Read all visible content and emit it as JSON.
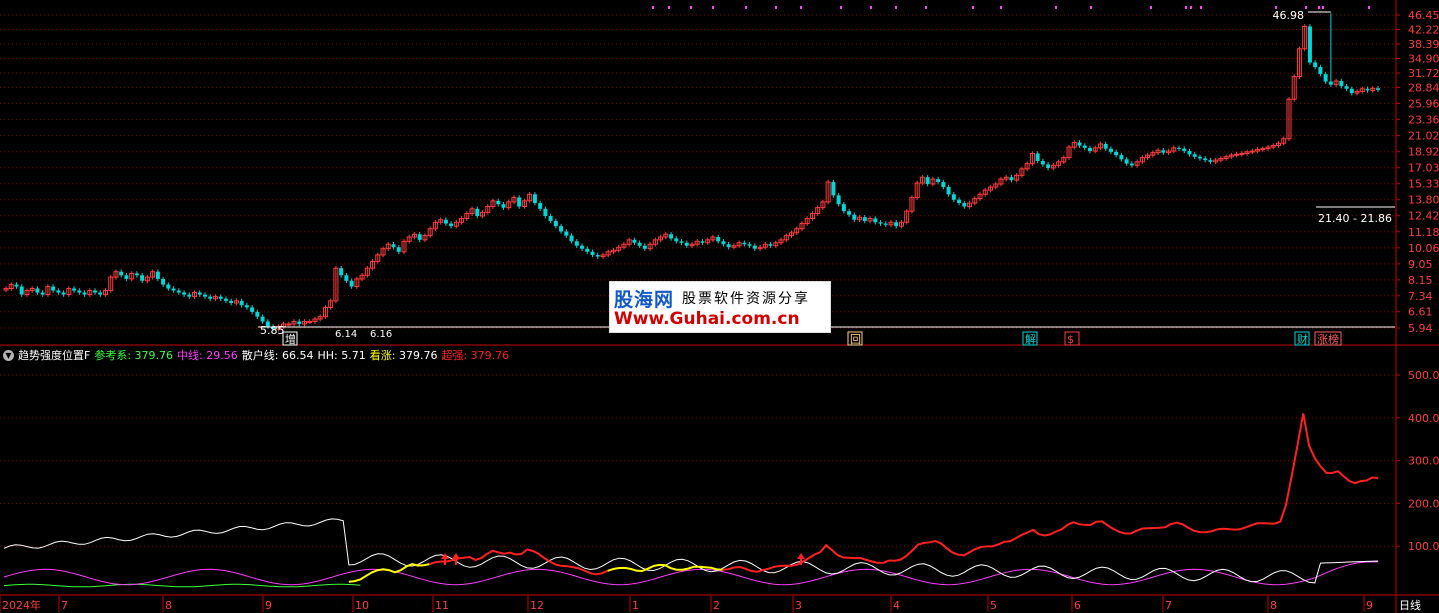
{
  "colors": {
    "up": "#ff3c3c",
    "down": "#00d8d8",
    "grid": "#8a0000",
    "axis": "#c00000",
    "tick": "#ff3c3c",
    "ref": "#3cff3c",
    "mid": "#ff3cff",
    "retail": "#ffffff",
    "hh": "#ffffff",
    "bull": "#ffff00",
    "strong": "#ff2020",
    "top_marks": "#ff3cff"
  },
  "indicator": {
    "title": "趋势强度位置F",
    "items": [
      {
        "label": "参考系:",
        "value": "379.76",
        "color": "#3cff3c"
      },
      {
        "label": "中线:",
        "value": "29.56",
        "color": "#ff3cff"
      },
      {
        "label": "散户线:",
        "value": "66.54",
        "color": "#ffffff"
      },
      {
        "label": "HH:",
        "value": "5.71",
        "color": "#ffffff"
      },
      {
        "label": "看涨:",
        "value": "379.76",
        "color": "#ffff00"
      },
      {
        "label": "超强:",
        "value": "379.76",
        "color": "#ff2020"
      }
    ]
  },
  "watermark": {
    "logo": "股海网",
    "slogan": "股票软件资源分享",
    "url": "Www.Guhai.com.cn"
  },
  "period_label": "日线",
  "chart_data": [
    {
      "type": "candlestick",
      "name": "price",
      "y_ticks": [
        "46.45",
        "42.22",
        "38.39",
        "34.90",
        "31.72",
        "28.84",
        "25.96",
        "23.36",
        "21.02",
        "18.92",
        "17.03",
        "15.33",
        "13.80",
        "12.42",
        "11.18",
        "10.06",
        "9.05",
        "8.15",
        "7.34",
        "6.61",
        "5.94"
      ],
      "annotations": {
        "high_label": "46.98",
        "low_label": "5.85",
        "range_label": "21.40 - 21.86",
        "small_labels": [
          "6.14",
          "6.16"
        ]
      },
      "event_markers": [
        "增",
        "回",
        "解",
        "$",
        "财",
        "涨榜"
      ],
      "closes": [
        7.7,
        7.9,
        7.8,
        7.4,
        7.6,
        7.7,
        7.5,
        7.4,
        7.8,
        7.6,
        7.5,
        7.4,
        7.7,
        7.6,
        7.5,
        7.4,
        7.6,
        7.5,
        7.4,
        7.6,
        8.3,
        8.6,
        8.4,
        8.2,
        8.5,
        8.4,
        8.1,
        8.3,
        8.6,
        8.2,
        7.9,
        7.7,
        7.6,
        7.5,
        7.4,
        7.3,
        7.5,
        7.4,
        7.3,
        7.2,
        7.3,
        7.2,
        7.1,
        7.0,
        7.1,
        6.9,
        6.8,
        6.6,
        6.4,
        6.2,
        6.0,
        5.9,
        6.0,
        6.1,
        6.1,
        6.2,
        6.1,
        6.2,
        6.2,
        6.3,
        6.4,
        6.8,
        7.1,
        8.8,
        8.4,
        8.1,
        7.8,
        8.2,
        8.4,
        8.8,
        9.2,
        9.6,
        10.0,
        10.3,
        10.1,
        9.8,
        10.5,
        10.8,
        11.0,
        10.6,
        10.9,
        11.4,
        11.9,
        12.1,
        11.8,
        11.6,
        11.9,
        12.2,
        12.6,
        13.0,
        12.4,
        12.7,
        13.2,
        13.7,
        13.4,
        13.1,
        13.6,
        14.0,
        13.2,
        13.7,
        14.3,
        13.5,
        13.0,
        12.4,
        12.0,
        11.6,
        11.2,
        10.9,
        10.5,
        10.2,
        10.0,
        9.8,
        9.6,
        9.5,
        9.6,
        9.8,
        9.9,
        10.1,
        10.3,
        10.6,
        10.4,
        10.2,
        10.0,
        10.3,
        10.6,
        10.8,
        11.0,
        10.7,
        10.5,
        10.4,
        10.2,
        10.3,
        10.5,
        10.4,
        10.6,
        10.8,
        10.5,
        10.3,
        10.1,
        10.2,
        10.4,
        10.3,
        10.2,
        10.0,
        10.1,
        10.3,
        10.2,
        10.4,
        10.6,
        10.9,
        11.1,
        11.4,
        11.8,
        12.2,
        12.6,
        13.1,
        13.6,
        15.5,
        14.2,
        13.4,
        12.8,
        12.5,
        12.1,
        12.3,
        12.0,
        12.2,
        11.9,
        11.8,
        11.7,
        11.9,
        11.6,
        11.9,
        12.8,
        14.0,
        15.4,
        16.0,
        15.3,
        15.8,
        15.5,
        15.0,
        14.3,
        13.8,
        13.5,
        13.2,
        13.5,
        13.9,
        14.3,
        14.7,
        15.0,
        15.3,
        15.8,
        16.0,
        15.7,
        16.2,
        16.9,
        17.5,
        18.7,
        17.8,
        17.4,
        17.0,
        17.3,
        17.7,
        18.2,
        19.5,
        20.1,
        19.7,
        19.4,
        19.0,
        19.4,
        19.9,
        19.3,
        18.9,
        18.5,
        18.0,
        17.5,
        17.3,
        17.7,
        18.2,
        18.5,
        18.8,
        19.1,
        18.8,
        19.0,
        19.4,
        19.3,
        19.0,
        18.6,
        18.3,
        18.1,
        17.9,
        17.7,
        17.9,
        18.1,
        18.3,
        18.5,
        18.6,
        18.7,
        18.9,
        19.0,
        19.2,
        19.3,
        19.5,
        19.7,
        20.0,
        20.6,
        26.7,
        31.0,
        37.2,
        43.1,
        34.0,
        33.0,
        31.5,
        30.0,
        29.4,
        30.1,
        29.1,
        28.6,
        27.8,
        28.1,
        28.6,
        28.3,
        28.7,
        28.4
      ]
    },
    {
      "type": "line",
      "name": "趋势强度位置F",
      "y_ticks": [
        "500.0",
        "400.0",
        "300.0",
        "200.0",
        "100.0"
      ],
      "x_ticks": [
        "2024年",
        "7",
        "8",
        "9",
        "10",
        "11",
        "12",
        "1",
        "2",
        "3",
        "4",
        "5",
        "6",
        "7",
        "8",
        "9"
      ],
      "signal_arrows": 3
    }
  ]
}
